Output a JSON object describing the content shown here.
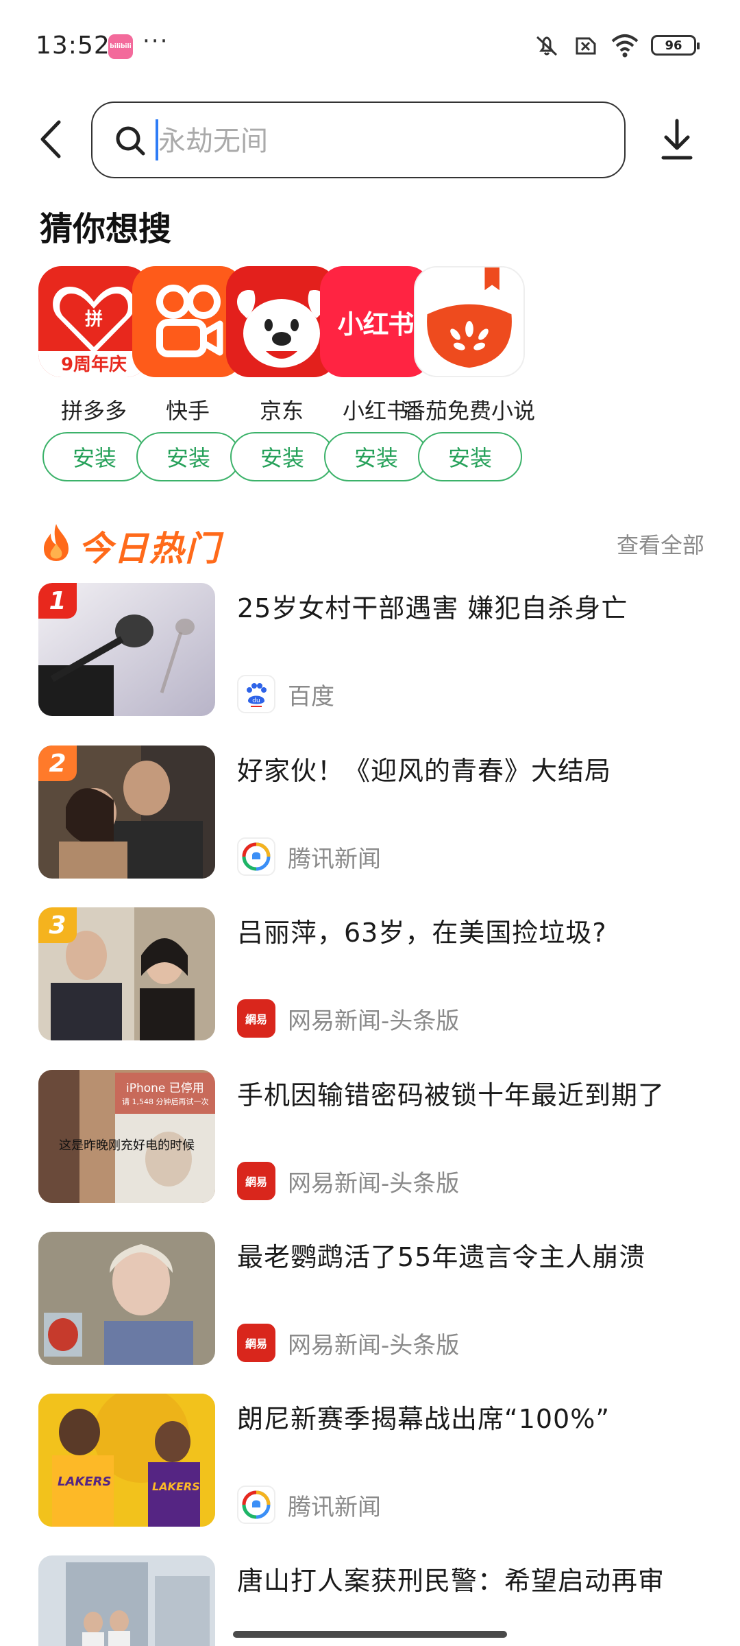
{
  "status_bar": {
    "time": "13:52",
    "app_icon_text": "bilibili",
    "more": "···",
    "battery": "96",
    "icons": [
      "mute-icon",
      "sim-off-icon",
      "wifi-icon",
      "battery-icon"
    ]
  },
  "search": {
    "placeholder": "永劫无间",
    "value": ""
  },
  "guess": {
    "title": "猜你想搜",
    "apps": [
      {
        "name": "拼多多",
        "install": "安装",
        "badge": "9周年庆",
        "color": "#e8281d"
      },
      {
        "name": "快手",
        "install": "安装",
        "color": "#fe5b1a"
      },
      {
        "name": "京东",
        "install": "安装",
        "color": "#e3201c"
      },
      {
        "name": "小红书",
        "install": "安装",
        "logo_text": "小红书",
        "color": "#ff2442"
      },
      {
        "name": "番茄免费小说",
        "install": "安装",
        "color": "#ee4b1e"
      }
    ]
  },
  "hot": {
    "title": "今日热门",
    "view_all": "查看全部",
    "items": [
      {
        "rank": "1",
        "title": "25岁女村干部遇害 嫌犯自杀身亡",
        "source": "百度",
        "rank_color": "#e8281d"
      },
      {
        "rank": "2",
        "title": "好家伙！《迎风的青春》大结局",
        "source": "腾讯新闻",
        "rank_color": "#ff7a2a"
      },
      {
        "rank": "3",
        "title": "吕丽萍，63岁，在美国捡垃圾?",
        "source": "网易新闻-头条版",
        "rank_color": "#f5b31e"
      },
      {
        "rank": "",
        "title": "手机因输错密码被锁十年最近到期了",
        "source": "网易新闻-头条版",
        "thumb_text_1": "iPhone 已停用",
        "thumb_text_2": "请 1,548 分钟后再试一次",
        "thumb_text_3": "这是昨晚刚充好电的时候"
      },
      {
        "rank": "",
        "title": "最老鹦鹉活了55年遗言令主人崩溃",
        "source": "网易新闻-头条版"
      },
      {
        "rank": "",
        "title": "朗尼新赛季揭幕战出席“100%”",
        "source": "腾讯新闻",
        "thumb_text_1": "LAKERS",
        "thumb_text_2": "LAKERS"
      },
      {
        "rank": "",
        "title": "唐山打人案获刑民警：希望启动再审",
        "source": ""
      }
    ]
  },
  "source_logo_text": {
    "baidu": "du",
    "netease": "網易"
  }
}
